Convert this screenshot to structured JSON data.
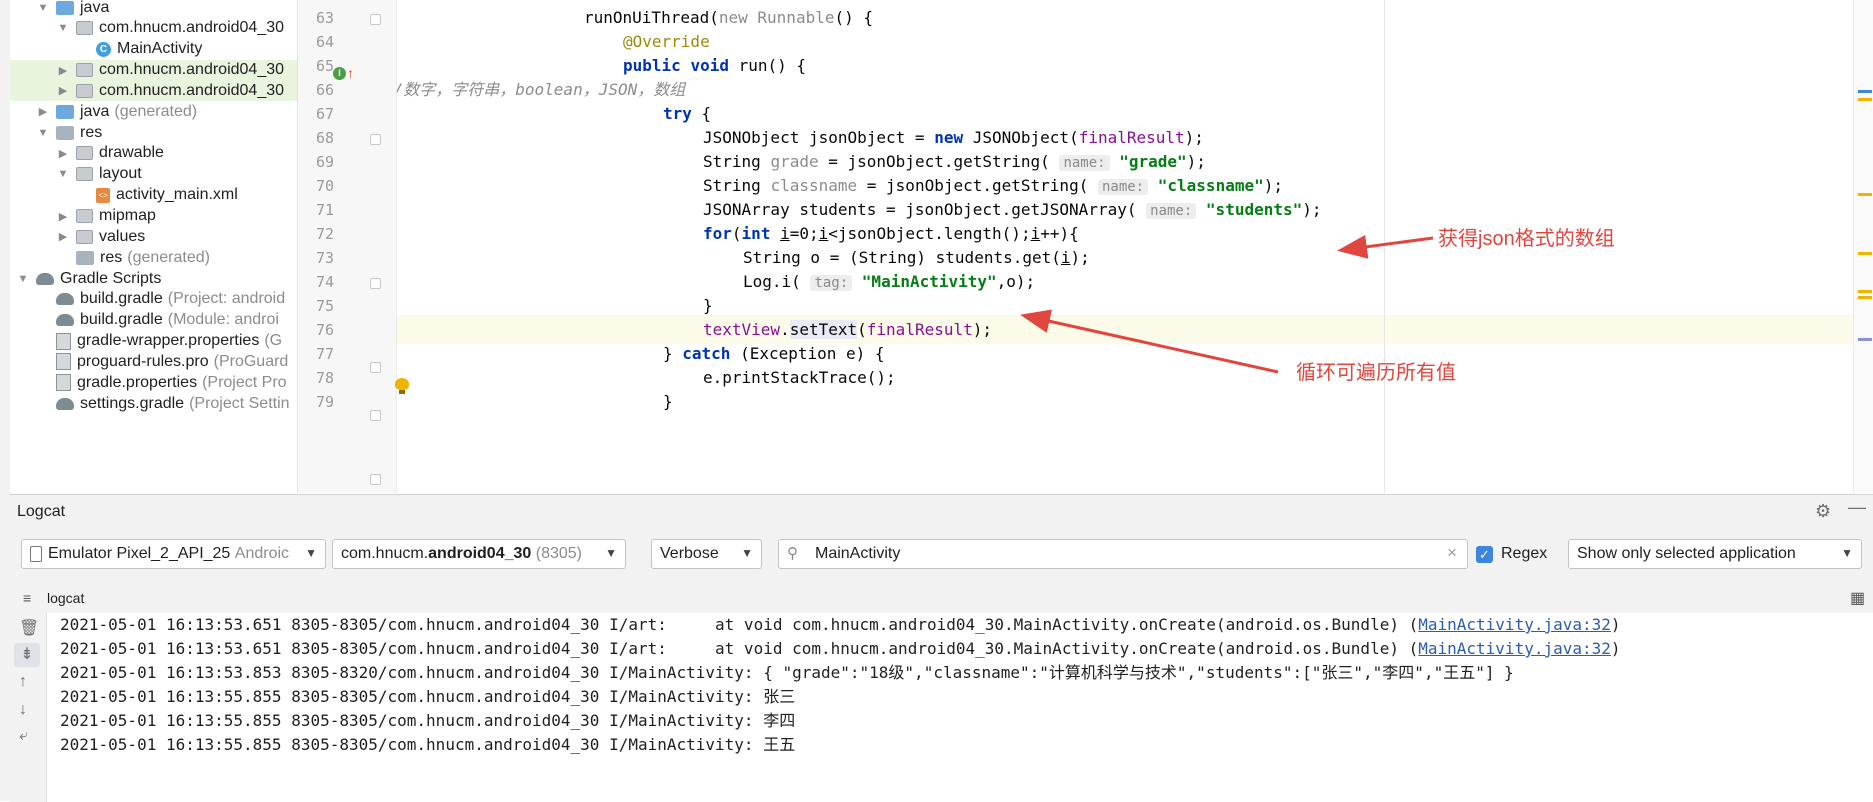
{
  "project_tree": {
    "items": [
      {
        "label": "java",
        "suffix": "",
        "icon": "folder-blue-icon",
        "arrow": "down",
        "indent": 26
      },
      {
        "label": "com.hnucm.android04_30",
        "suffix": "",
        "icon": "package-icon",
        "arrow": "down",
        "indent": 46
      },
      {
        "label": "MainActivity",
        "suffix": "",
        "icon": "class-icon",
        "arrow": "none",
        "indent": 66
      },
      {
        "label": "com.hnucm.android04_30",
        "suffix": "",
        "icon": "package-icon",
        "arrow": "right",
        "indent": 46
      },
      {
        "label": "com.hnucm.android04_30",
        "suffix": "",
        "icon": "package-icon",
        "arrow": "right",
        "indent": 46
      },
      {
        "label": "java",
        "suffix": "(generated)",
        "icon": "folder-generated-icon",
        "arrow": "right",
        "indent": 26
      },
      {
        "label": "res",
        "suffix": "",
        "icon": "res-folder-icon",
        "arrow": "down",
        "indent": 26
      },
      {
        "label": "drawable",
        "suffix": "",
        "icon": "folder-icon",
        "arrow": "right",
        "indent": 46
      },
      {
        "label": "layout",
        "suffix": "",
        "icon": "folder-icon",
        "arrow": "down",
        "indent": 46
      },
      {
        "label": "activity_main.xml",
        "suffix": "",
        "icon": "xml-file-icon",
        "arrow": "none",
        "indent": 66
      },
      {
        "label": "mipmap",
        "suffix": "",
        "icon": "folder-icon",
        "arrow": "right",
        "indent": 46
      },
      {
        "label": "values",
        "suffix": "",
        "icon": "folder-icon",
        "arrow": "right",
        "indent": 46
      },
      {
        "label": "res",
        "suffix": "(generated)",
        "icon": "res-folder-icon",
        "arrow": "none",
        "indent": 46
      },
      {
        "label": "Gradle Scripts",
        "suffix": "",
        "icon": "gradle-icon",
        "arrow": "down",
        "indent": 6
      },
      {
        "label": "build.gradle",
        "suffix": "(Project: android",
        "icon": "gradle-file-icon",
        "arrow": "none",
        "indent": 26
      },
      {
        "label": "build.gradle",
        "suffix": "(Module: androi",
        "icon": "gradle-file-icon",
        "arrow": "none",
        "indent": 26
      },
      {
        "label": "gradle-wrapper.properties",
        "suffix": "(G",
        "icon": "properties-file-icon",
        "arrow": "none",
        "indent": 26
      },
      {
        "label": "proguard-rules.pro",
        "suffix": "(ProGuard",
        "icon": "pro-file-icon",
        "arrow": "none",
        "indent": 26
      },
      {
        "label": "gradle.properties",
        "suffix": "(Project Pro",
        "icon": "properties-file-icon",
        "arrow": "none",
        "indent": 26
      },
      {
        "label": "settings.gradle",
        "suffix": "(Project Settin",
        "icon": "gradle-file-icon",
        "arrow": "none",
        "indent": 26
      }
    ]
  },
  "editor": {
    "line_numbers": [
      "63",
      "64",
      "65",
      "66",
      "67",
      "68",
      "69",
      "70",
      "71",
      "72",
      "73",
      "74",
      "75",
      "76",
      "77",
      "78",
      "79"
    ],
    "lines": {
      "l63": {
        "a": "runOnUiThread(",
        "kw": "new",
        "b": "Runnable",
        "c": "() {"
      },
      "l64": {
        "ann": "@Override"
      },
      "l65": {
        "kw1": "public",
        "kw2": "void",
        "rest": "run() {"
      },
      "l66": {
        "comment": "//数字，字符串，boolean，JSON，数组"
      },
      "l67": {
        "kw": "try",
        "rest": "{"
      },
      "l68": {
        "a": "JSONObject jsonObject = ",
        "kw": "new",
        "b": "JSONObject(",
        "fld": "finalResult",
        "c": ");"
      },
      "l69": {
        "a": "String ",
        "var": "grade",
        "b": " = jsonObject.getString(",
        "hint": "name:",
        "str": "\"grade\"",
        "c": ");"
      },
      "l70": {
        "a": "String ",
        "var": "classname",
        "b": " = jsonObject.getString(",
        "hint": "name:",
        "str": "\"classname\"",
        "c": ");"
      },
      "l71": {
        "a": "JSONArray students = jsonObject.getJSONArray(",
        "hint": "name:",
        "str": "\"students\"",
        "c": ");"
      },
      "l72": {
        "kw1": "for",
        "a": "(",
        "kw2": "int",
        "b": " ",
        "i1": "i",
        "c": "=0;",
        "i2": "i",
        "d": "<jsonObject.length();",
        "i3": "i",
        "e": "++){"
      },
      "l73": {
        "a": "String o = (String) students.get(",
        "i": "i",
        "b": ");"
      },
      "l74": {
        "a": "Log.i(",
        "hint": "tag:",
        "str": "\"MainActivity\"",
        "b": ",o);"
      },
      "l75": {
        "a": "}"
      },
      "l76": {
        "fld": "textView",
        "a": ".",
        "sel": "setText",
        "b": "(",
        "fld2": "finalResult",
        "c": ");"
      },
      "l77": {
        "a": "} ",
        "kw": "catch",
        "b": " (Exception e) {"
      },
      "l78": {
        "a": "e.printStackTrace();"
      },
      "l79": {
        "a": "}"
      }
    },
    "callouts": {
      "json_array": "获得json格式的数组",
      "loop": "循环可遍历所有值"
    },
    "accent_colors": {
      "callout": "#e0463e",
      "keyword": "#0033b3",
      "string": "#067d17",
      "field": "#871094"
    }
  },
  "logcat": {
    "title": "Logcat",
    "device": {
      "name": "Emulator Pixel_2_API_25",
      "suffix": "Androic"
    },
    "process": {
      "prefix": "com.hnucm.",
      "bold": "android04_30",
      "pid": "(8305)"
    },
    "level": "Verbose",
    "search": {
      "value": "MainActivity"
    },
    "regex": {
      "label": "Regex",
      "checked": true
    },
    "filter": "Show only selected application",
    "subtab": "logcat",
    "lines": [
      {
        "text": "2021-05-01 16:13:53.651 8305-8305/com.hnucm.android04_30 I/art:     at void com.hnucm.android04_30.MainActivity.onCreate(android.os.Bundle) (",
        "link": "MainActivity.java:32",
        "end": ")"
      },
      {
        "text": "2021-05-01 16:13:53.651 8305-8305/com.hnucm.android04_30 I/art:     at void com.hnucm.android04_30.MainActivity.onCreate(android.os.Bundle) (",
        "link": "MainActivity.java:32",
        "end": ")"
      },
      {
        "text": "2021-05-01 16:13:53.853 8305-8320/com.hnucm.android04_30 I/MainActivity: { \"grade\":\"18级\",\"classname\":\"计算机科学与技术\",\"students\":[\"张三\",\"李四\",\"王五\"] }",
        "link": "",
        "end": ""
      },
      {
        "text": "2021-05-01 16:13:55.855 8305-8305/com.hnucm.android04_30 I/MainActivity: 张三",
        "link": "",
        "end": ""
      },
      {
        "text": "2021-05-01 16:13:55.855 8305-8305/com.hnucm.android04_30 I/MainActivity: 李四",
        "link": "",
        "end": ""
      },
      {
        "text": "2021-05-01 16:13:55.855 8305-8305/com.hnucm.android04_30 I/MainActivity: 王五",
        "link": "",
        "end": ""
      }
    ]
  }
}
